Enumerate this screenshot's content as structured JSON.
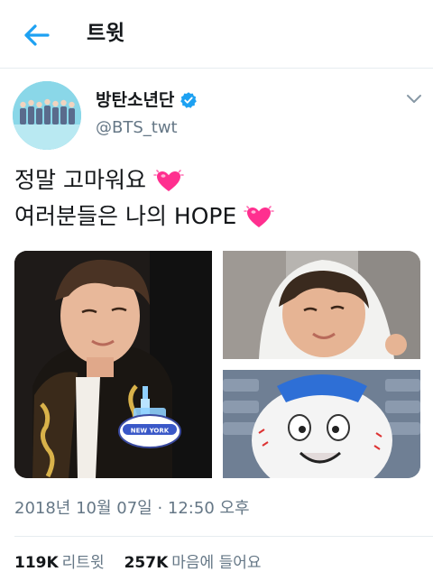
{
  "header": {
    "title": "트윗",
    "back_icon": "arrow-left-icon"
  },
  "author": {
    "display_name": "방탄소년단",
    "handle": "@BTS_twt",
    "verified_icon": "verified-badge-icon"
  },
  "tweet": {
    "line1": "정말 고마워요",
    "line2": "여러분들은 나의 HOPE",
    "heart_icon": "sparkling-heart-icon",
    "timestamp": "2018년 10월 07일 · 12:50 오후",
    "photo_overlay_text": "NEW YORK"
  },
  "stats": {
    "retweets_count": "119K",
    "retweets_label": "리트윗",
    "likes_count": "257K",
    "likes_label": "마음에 들어요"
  },
  "colors": {
    "accent": "#1da1f2",
    "text": "#14171a",
    "muted": "#657786",
    "heart": "#ff2f8f"
  }
}
